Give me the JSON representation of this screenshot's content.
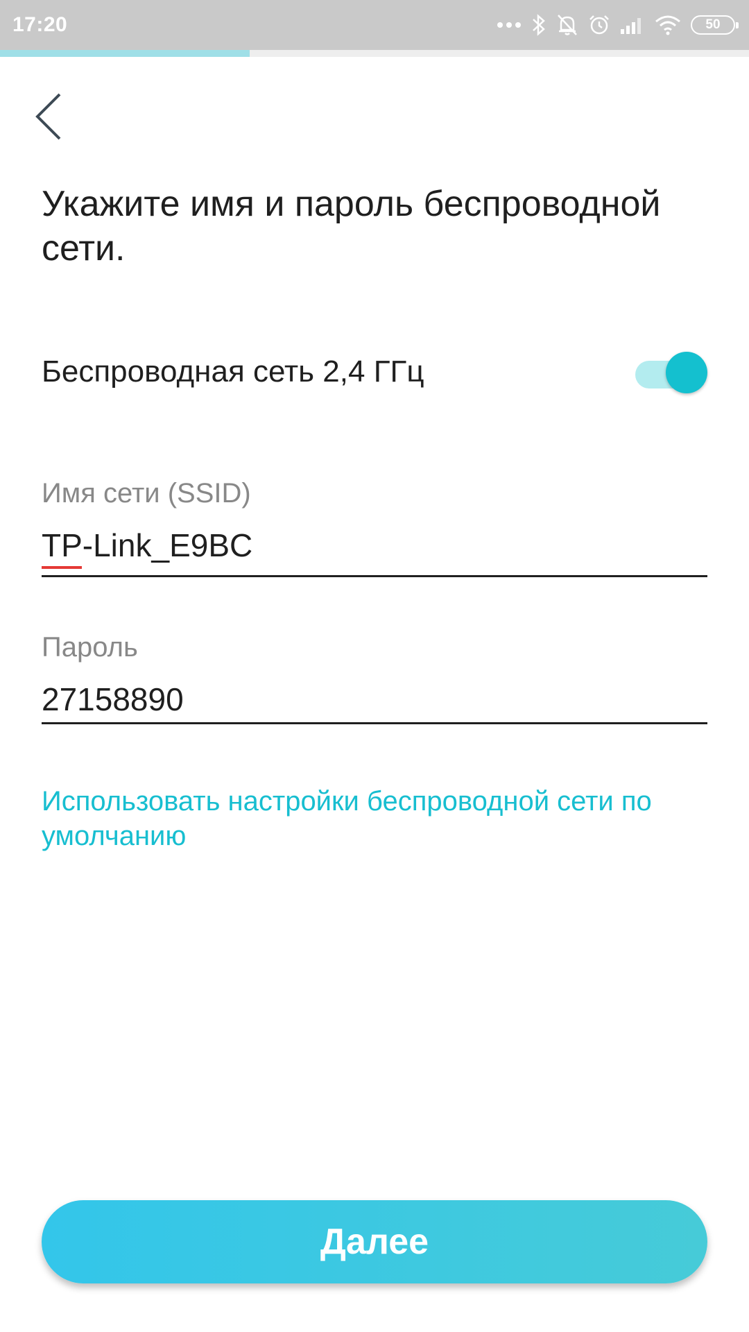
{
  "status_bar": {
    "time": "17:20",
    "battery": "50",
    "icons": [
      "more-dots-icon",
      "bluetooth-icon",
      "notifications-off-icon",
      "alarm-icon",
      "signal-icon",
      "wifi-icon",
      "battery-icon"
    ]
  },
  "progress": {
    "fraction": 0.333,
    "fill_color": "#9fdfe7"
  },
  "header": {
    "back_icon": "chevron-left-icon"
  },
  "title": "Укажите имя и пароль беспроводной сети.",
  "wireless_24": {
    "label": "Беспроводная сеть 2,4 ГГц",
    "enabled": true,
    "accent": "#14c0cf"
  },
  "ssid": {
    "label": "Имя сети (SSID)",
    "value": "TP-Link_E9BC"
  },
  "password": {
    "label": "Пароль",
    "value": "27158890"
  },
  "default_link": "Использовать настройки беспроводной сети по умолчанию",
  "next_button": "Далее"
}
